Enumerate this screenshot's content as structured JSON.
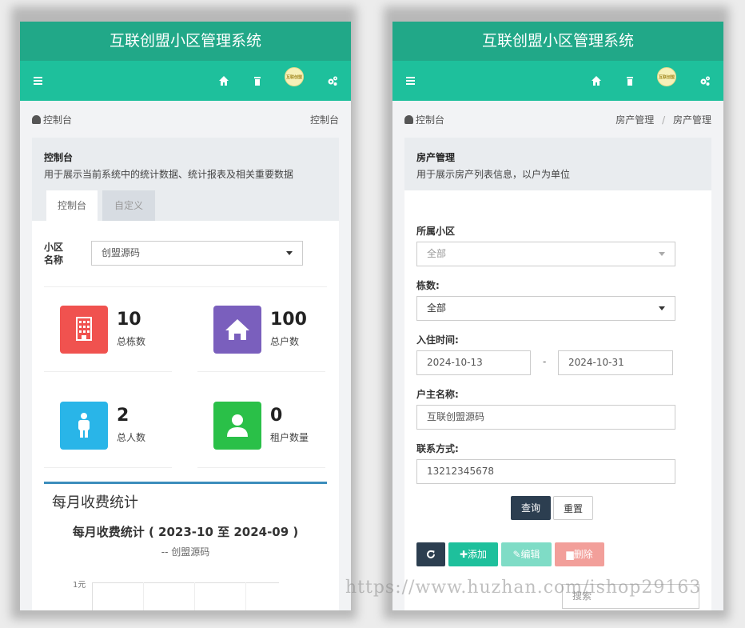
{
  "left": {
    "app_title": "互联创盟小区管理系统",
    "logo_text": "互联创盟",
    "breadcrumb": {
      "label": "控制台",
      "current": "控制台"
    },
    "panel": {
      "title": "控制台",
      "desc": "用于展示当前系统中的统计数据、统计报表及相关重要数据"
    },
    "tabs": [
      {
        "label": "控制台"
      },
      {
        "label": "自定义"
      }
    ],
    "filter": {
      "label": "小区名称",
      "value": "创盟源码"
    },
    "stats": [
      {
        "value": "10",
        "label": "总栋数",
        "color": "#f0524f",
        "icon": "building-icon"
      },
      {
        "value": "100",
        "label": "总户数",
        "color": "#7a5fbd",
        "icon": "house-icon"
      },
      {
        "value": "2",
        "label": "总人数",
        "color": "#29b5e8",
        "icon": "person-icon"
      },
      {
        "value": "0",
        "label": "租户数量",
        "color": "#2ac048",
        "icon": "user-icon"
      }
    ],
    "chart": {
      "box_title": "每月收费统计",
      "title": "每月收费统计 ( 2023-10 至 2024-09 )",
      "subtitle": "-- 创盟源码",
      "ytick": "1元"
    }
  },
  "right": {
    "app_title": "互联创盟小区管理系统",
    "logo_text": "互联创盟",
    "breadcrumb": {
      "label": "控制台",
      "parent": "房产管理",
      "sep": "/",
      "current": "房产管理"
    },
    "panel": {
      "title": "房产管理",
      "desc": "用于展示房产列表信息，以户为单位"
    },
    "form": {
      "community_label": "所属小区",
      "community_value": "全部",
      "building_label": "栋数:",
      "building_value": "全部",
      "checkin_label": "入住时间:",
      "date_from": "2024-10-13",
      "date_sep": "-",
      "date_to": "2024-10-31",
      "owner_label": "户主名称:",
      "owner_value": "互联创盟源码",
      "contact_label": "联系方式:",
      "contact_value": "13212345678",
      "query_label": "查询",
      "reset_label": "重置"
    },
    "toolbar": {
      "add_label": "添加",
      "edit_label": "编辑",
      "delete_label": "删除"
    },
    "search": {
      "placeholder": "搜索"
    }
  },
  "watermark": "https://www.huzhan.com/ishop29163",
  "colors": {
    "title_green": "#21a888",
    "nav_green": "#1ec09c",
    "dark_btn": "#2c3e50"
  }
}
